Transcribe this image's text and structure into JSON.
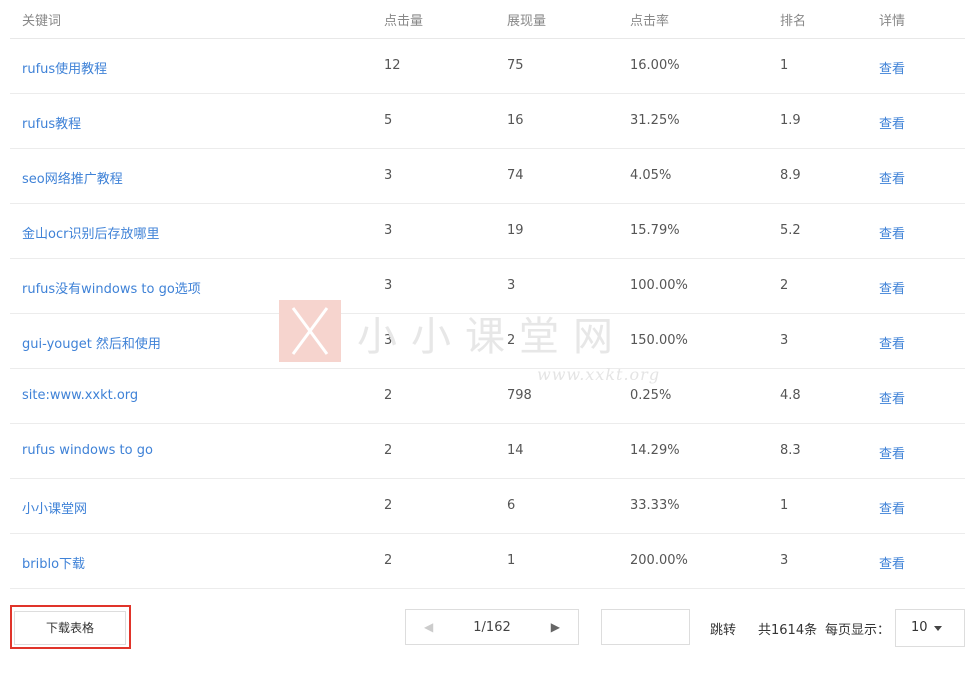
{
  "table": {
    "headers": [
      "关键词",
      "点击量",
      "展现量",
      "点击率",
      "排名",
      "详情"
    ],
    "rows": [
      {
        "keyword": "rufus使用教程",
        "clicks": "12",
        "impressions": "75",
        "ctr": "16.00%",
        "rank": "1",
        "detail": "查看"
      },
      {
        "keyword": "rufus教程",
        "clicks": "5",
        "impressions": "16",
        "ctr": "31.25%",
        "rank": "1.9",
        "detail": "查看"
      },
      {
        "keyword": "seo网络推广教程",
        "clicks": "3",
        "impressions": "74",
        "ctr": "4.05%",
        "rank": "8.9",
        "detail": "查看"
      },
      {
        "keyword": "金山ocr识别后存放哪里",
        "clicks": "3",
        "impressions": "19",
        "ctr": "15.79%",
        "rank": "5.2",
        "detail": "查看"
      },
      {
        "keyword": "rufus没有windows to go选项",
        "clicks": "3",
        "impressions": "3",
        "ctr": "100.00%",
        "rank": "2",
        "detail": "查看"
      },
      {
        "keyword": "gui-youget 然后和使用",
        "clicks": "3",
        "impressions": "2",
        "ctr": "150.00%",
        "rank": "3",
        "detail": "查看"
      },
      {
        "keyword": "site:www.xxkt.org",
        "clicks": "2",
        "impressions": "798",
        "ctr": "0.25%",
        "rank": "4.8",
        "detail": "查看"
      },
      {
        "keyword": "rufus windows to go",
        "clicks": "2",
        "impressions": "14",
        "ctr": "14.29%",
        "rank": "8.3",
        "detail": "查看"
      },
      {
        "keyword": "小小课堂网",
        "clicks": "2",
        "impressions": "6",
        "ctr": "33.33%",
        "rank": "1",
        "detail": "查看"
      },
      {
        "keyword": "briblo下载",
        "clicks": "2",
        "impressions": "1",
        "ctr": "200.00%",
        "rank": "3",
        "detail": "查看"
      }
    ]
  },
  "watermark": {
    "text": "小小课堂网",
    "url": "www.xxkt.org",
    "logo_icon": "x-logo-icon"
  },
  "footer": {
    "download_label": "下载表格",
    "pagination": {
      "current": "1/162",
      "prev_icon": "chevron-left-icon",
      "next_icon": "chevron-right-icon"
    },
    "jump_value": "",
    "jump_label": "跳转",
    "total_label": "共1614条",
    "per_page_label": "每页显示：",
    "per_page_value": "10"
  },
  "colors": {
    "link": "#3f82d7",
    "highlight_outline": "#e0342a",
    "border": "#dddddd"
  }
}
